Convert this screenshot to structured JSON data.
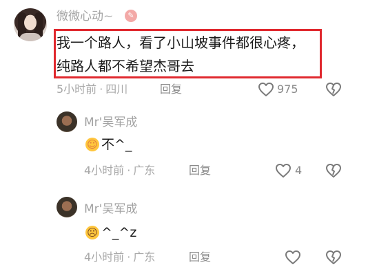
{
  "comment": {
    "username": "微微心动",
    "username_suffix": "~",
    "lines": [
      "我一个路人，看了小山坡事件都很心疼，",
      "纯路人都不希望杰哥去"
    ],
    "time": "5小时前",
    "location": "四川",
    "reply_label": "回复",
    "likes": "975"
  },
  "replies": [
    {
      "username": "Mr'吴军成",
      "emoji": "hugging-face",
      "text": "不^_",
      "time": "4小时前",
      "location": "广东",
      "reply_label": "回复",
      "likes": "4"
    },
    {
      "username": "Mr'吴军成",
      "emoji": "downcast-sweat-face",
      "text": "^_^z",
      "time": "4小时前",
      "location": "广东",
      "reply_label": "回复",
      "likes": ""
    }
  ],
  "icons": {
    "like": "heart-outline-icon",
    "dislike": "broken-heart-outline-icon",
    "badge": "pink-badge-icon"
  },
  "colors": {
    "highlight_border": "#e0282e",
    "muted_text": "#a3a3a3",
    "body_text": "#1c1c1c"
  }
}
